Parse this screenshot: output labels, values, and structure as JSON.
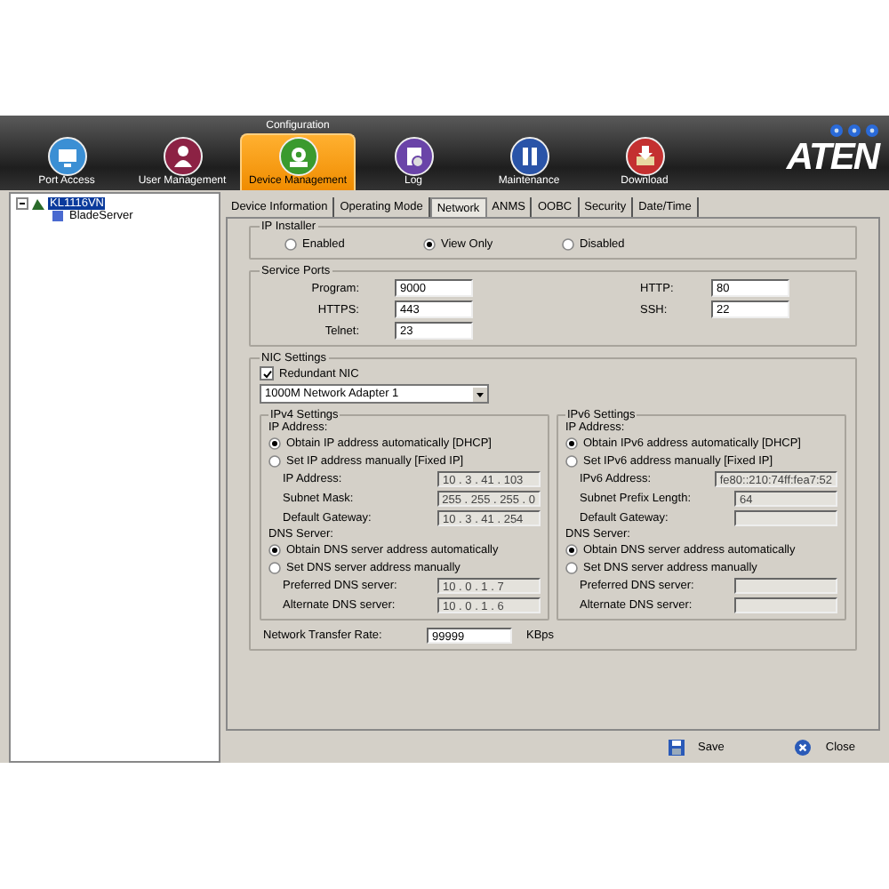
{
  "header": {
    "group_label": "Configuration",
    "logo": "ATEN",
    "nav": [
      {
        "label": "Port Access",
        "selected": false
      },
      {
        "label": "User Management",
        "selected": false
      },
      {
        "label": "Device Management",
        "selected": true
      },
      {
        "label": "Log",
        "selected": false
      },
      {
        "label": "Maintenance",
        "selected": false
      },
      {
        "label": "Download",
        "selected": false
      }
    ]
  },
  "tree": [
    {
      "label": "KL1116VN",
      "selected": true,
      "expanded": true,
      "children": [
        {
          "label": "BladeServer",
          "selected": false
        }
      ]
    }
  ],
  "tabs": [
    {
      "label": "Device Information",
      "selected": false
    },
    {
      "label": "Operating Mode",
      "selected": false
    },
    {
      "label": "Network",
      "selected": true
    },
    {
      "label": "ANMS",
      "selected": false
    },
    {
      "label": "OOBC",
      "selected": false
    },
    {
      "label": "Security",
      "selected": false
    },
    {
      "label": "Date/Time",
      "selected": false
    }
  ],
  "ip_installer": {
    "title": "IP Installer",
    "options": [
      {
        "label": "Enabled",
        "selected": false
      },
      {
        "label": "View Only",
        "selected": true
      },
      {
        "label": "Disabled",
        "selected": false
      }
    ]
  },
  "service_ports": {
    "title": "Service Ports",
    "left": [
      {
        "label": "Program:",
        "value": "9000"
      },
      {
        "label": "HTTPS:",
        "value": "443"
      },
      {
        "label": "Telnet:",
        "value": "23"
      }
    ],
    "right": [
      {
        "label": "HTTP:",
        "value": "80"
      },
      {
        "label": "SSH:",
        "value": "22"
      }
    ]
  },
  "nic": {
    "title": "NIC Settings",
    "redundant": {
      "label": "Redundant NIC",
      "checked": true
    },
    "adapter": "1000M Network Adapter 1",
    "panels": [
      {
        "title": "IPv4 Settings",
        "ip_heading": "IP Address:",
        "ip_options": [
          {
            "label": "Obtain IP address automatically [DHCP]",
            "selected": true
          },
          {
            "label": "Set IP address manually [Fixed IP]",
            "selected": false
          }
        ],
        "ip_fields": [
          {
            "label": "IP Address:",
            "value": "10 . 3 . 41 . 103",
            "disabled": true
          },
          {
            "label": "Subnet Mask:",
            "value": "255 . 255 . 255 . 0",
            "disabled": true
          },
          {
            "label": "Default Gateway:",
            "value": "10 . 3 . 41 . 254",
            "disabled": true
          }
        ],
        "dns_heading": "DNS Server:",
        "dns_options": [
          {
            "label": "Obtain DNS server address automatically",
            "selected": true
          },
          {
            "label": "Set DNS server address manually",
            "selected": false
          }
        ],
        "dns_fields": [
          {
            "label": "Preferred DNS server:",
            "value": "10 . 0 . 1 . 7",
            "disabled": true
          },
          {
            "label": "Alternate DNS server:",
            "value": "10 . 0 . 1 . 6",
            "disabled": true
          }
        ]
      },
      {
        "title": "IPv6 Settings",
        "ip_heading": "IP Address:",
        "ip_options": [
          {
            "label": "Obtain IPv6 address automatically [DHCP]",
            "selected": true
          },
          {
            "label": "Set IPv6 address manually [Fixed IP]",
            "selected": false
          }
        ],
        "ip_fields": [
          {
            "label": "IPv6 Address:",
            "value": "fe80::210:74ff:fea7:52",
            "disabled": true
          },
          {
            "label": "Subnet Prefix Length:",
            "value": "64",
            "disabled": true
          },
          {
            "label": "Default Gateway:",
            "disabled": true
          }
        ],
        "dns_heading": "DNS Server:",
        "dns_options": [
          {
            "label": "Obtain DNS server address automatically",
            "selected": true
          },
          {
            "label": "Set DNS server address manually",
            "selected": false
          }
        ],
        "dns_fields": [
          {
            "label": "Preferred DNS server:",
            "disabled": true
          },
          {
            "label": "Alternate DNS server:",
            "disabled": true
          }
        ]
      }
    ],
    "transfer_rate": {
      "label": "Network Transfer Rate:",
      "value": "99999",
      "unit": "KBps"
    }
  },
  "footer": [
    {
      "kind": "save",
      "label": "Save"
    },
    {
      "kind": "close",
      "label": "Close"
    }
  ]
}
